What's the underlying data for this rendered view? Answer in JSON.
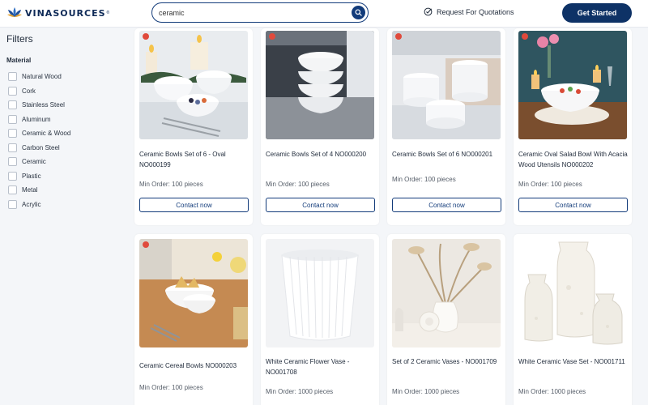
{
  "header": {
    "brand": "VINASOURCES",
    "brand_mark": "®",
    "search_value": "ceramic",
    "search_icon": "search-icon",
    "rfq_label": "Request For Quotations",
    "rfq_icon": "target-check-icon",
    "cta_label": "Get Started"
  },
  "sidebar": {
    "title": "Filters",
    "group_title": "Material",
    "items": [
      {
        "label": "Natural Wood"
      },
      {
        "label": "Cork"
      },
      {
        "label": "Stainless Steel"
      },
      {
        "label": "Aluminum"
      },
      {
        "label": "Ceramic & Wood"
      },
      {
        "label": "Carbon Steel"
      },
      {
        "label": "Ceramic"
      },
      {
        "label": "Plastic"
      },
      {
        "label": "Metal"
      },
      {
        "label": "Acrylic"
      }
    ]
  },
  "products": [
    {
      "name": "Ceramic Bowls Set of 6 - Oval NO000199",
      "min_order": "Min Order: 100 pieces",
      "action": "Contact now"
    },
    {
      "name": "Ceramic Bowls Set of 4 NO000200",
      "min_order": "Min Order: 100 pieces",
      "action": "Contact now"
    },
    {
      "name": "Ceramic Bowls Set of 6 NO000201",
      "min_order": "Min Order: 100 pieces",
      "action": "Contact now"
    },
    {
      "name": "Ceramic Oval Salad Bowl With Acacia Wood Utensils NO000202",
      "min_order": "Min Order: 100 pieces",
      "action": "Contact now"
    },
    {
      "name": "Ceramic Cereal Bowls NO000203",
      "min_order": "Min Order: 100 pieces"
    },
    {
      "name": "White Ceramic Flower Vase - NO001708",
      "min_order": "Min Order: 1000 pieces"
    },
    {
      "name": "Set of 2 Ceramic Vases - NO001709",
      "min_order": "Min Order: 1000 pieces"
    },
    {
      "name": "White Ceramic Vase Set - NO001711",
      "min_order": "Min Order: 1000 pieces"
    }
  ],
  "colors": {
    "brand_navy": "#0e3266",
    "accent_border": "#123b7a",
    "page_bg": "#f4f6f9"
  }
}
